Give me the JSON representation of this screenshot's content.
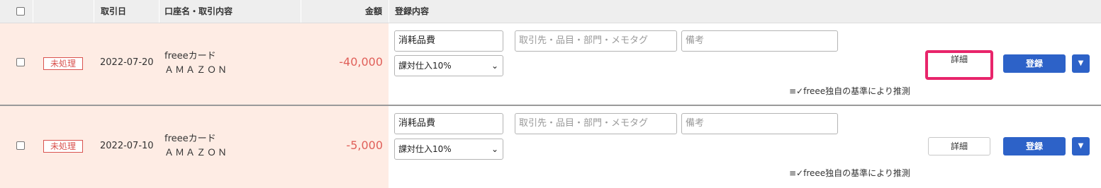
{
  "header": {
    "col_date": "取引日",
    "col_account": "口座名・取引内容",
    "col_amount": "金額",
    "col_registration": "登録内容"
  },
  "rows": [
    {
      "status": "未処理",
      "date": "2022-07-20",
      "account": "freeeカード",
      "description": "ＡＭＡＺＯＮ",
      "amount": "-40,000",
      "category": "消耗品費",
      "partner_placeholder": "取引先・品目・部門・メモタグ",
      "memo_placeholder": "備考",
      "tax": "課対仕入10%",
      "detail_label": "詳細",
      "register_label": "登録",
      "guess_text": "freee独自の基準により推測",
      "detail_highlighted": true
    },
    {
      "status": "未処理",
      "date": "2022-07-10",
      "account": "freeeカード",
      "description": "ＡＭＡＺＯＮ",
      "amount": "-5,000",
      "category": "消耗品費",
      "partner_placeholder": "取引先・品目・部門・メモタグ",
      "memo_placeholder": "備考",
      "tax": "課対仕入10%",
      "detail_label": "詳細",
      "register_label": "登録",
      "guess_text": "freee独自の基準により推測",
      "detail_highlighted": false
    }
  ],
  "colors": {
    "unprocessed_bg": "#feece4",
    "status_red": "#d9534f",
    "amount_red": "#e0605a",
    "primary_blue": "#2d62c8",
    "highlight_pink": "#e8256b"
  }
}
